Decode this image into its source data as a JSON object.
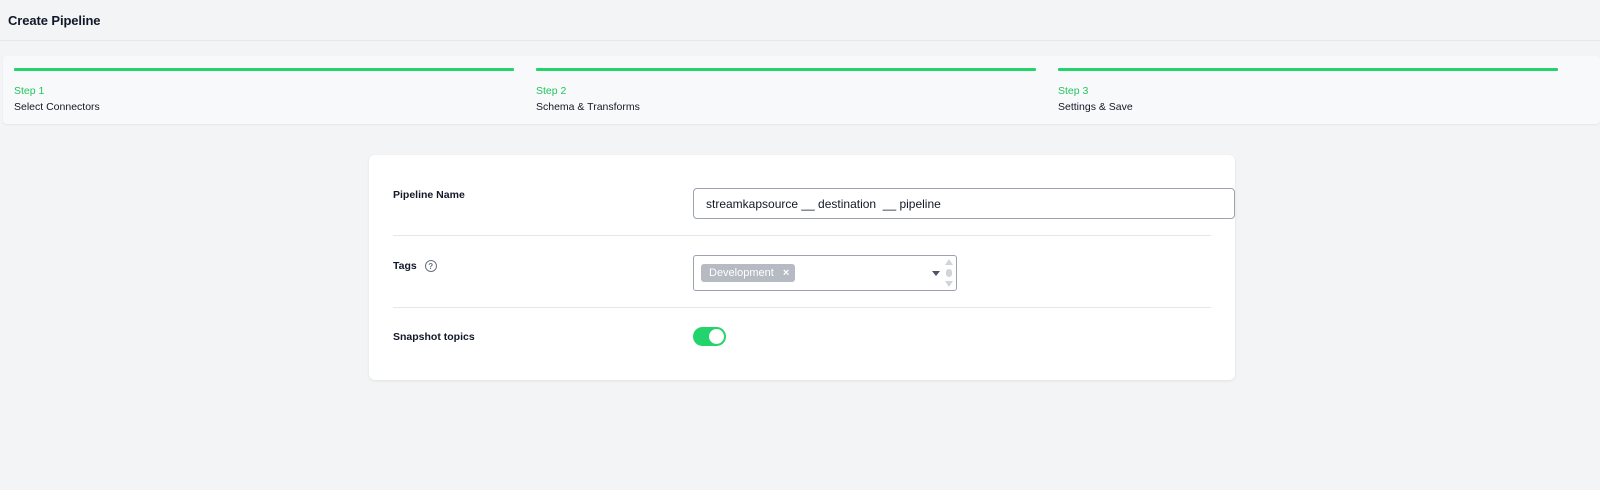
{
  "header": {
    "title": "Create Pipeline"
  },
  "colors": {
    "accent": "#22d46b",
    "step_number": "#22c55e"
  },
  "steps": [
    {
      "number": "Step 1",
      "label": "Select Connectors",
      "completed": true
    },
    {
      "number": "Step 2",
      "label": "Schema & Transforms",
      "completed": true
    },
    {
      "number": "Step 3",
      "label": "Settings & Save",
      "completed": true
    }
  ],
  "form": {
    "pipeline_name": {
      "label": "Pipeline Name",
      "value": "streamkapsource __ destination  __ pipeline"
    },
    "tags": {
      "label": "Tags",
      "help_icon": "question-circle-icon",
      "selected": [
        "Development"
      ],
      "remove_glyph": "×"
    },
    "snapshot": {
      "label": "Snapshot topics",
      "enabled": true
    }
  }
}
